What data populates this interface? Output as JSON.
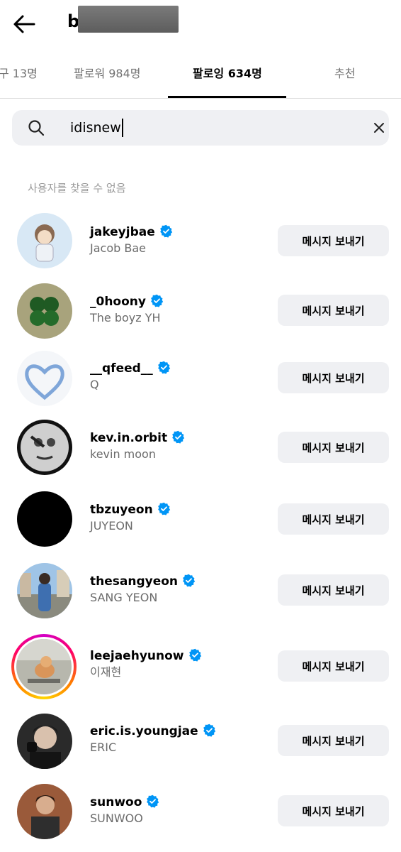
{
  "header": {
    "back_icon": "arrow-left-icon",
    "username_visible": "b"
  },
  "tabs": [
    {
      "label": "구 13명",
      "active": false
    },
    {
      "label": "팔로워 984명",
      "active": false
    },
    {
      "label": "팔로잉 634명",
      "active": true
    },
    {
      "label": "추천",
      "active": false
    }
  ],
  "search": {
    "value": "idisnew",
    "search_icon": "search-icon",
    "clear_icon": "close-icon"
  },
  "no_result_text": "사용자를 찾을 수 없음",
  "colors": {
    "verified": "#0095f6",
    "button_bg": "#eff0f3",
    "secondary_text": "#6b6b6b"
  },
  "users": [
    {
      "handle": "jakeyjbae",
      "name": "Jacob Bae",
      "verified": true,
      "button": "메시지 보내기"
    },
    {
      "handle": "_0hoony",
      "name": "The boyz YH",
      "verified": true,
      "button": "메시지 보내기"
    },
    {
      "handle": "__qfeed__",
      "name": "Q",
      "verified": true,
      "button": "메시지 보내기"
    },
    {
      "handle": "kev.in.orbit",
      "name": "kevin moon",
      "verified": true,
      "button": "메시지 보내기"
    },
    {
      "handle": "tbzuyeon",
      "name": "JUYEON",
      "verified": true,
      "button": "메시지 보내기"
    },
    {
      "handle": "thesangyeon",
      "name": "SANG YEON",
      "verified": true,
      "button": "메시지 보내기"
    },
    {
      "handle": "leejaehyunow",
      "name": "이재현",
      "verified": true,
      "button": "메시지 보내기",
      "story_ring": true
    },
    {
      "handle": "eric.is.youngjae",
      "name": "ERIC",
      "verified": true,
      "button": "메시지 보내기"
    },
    {
      "handle": "sunwoo",
      "name": "SUNWOO",
      "verified": true,
      "button": "메시지 보내기"
    }
  ]
}
